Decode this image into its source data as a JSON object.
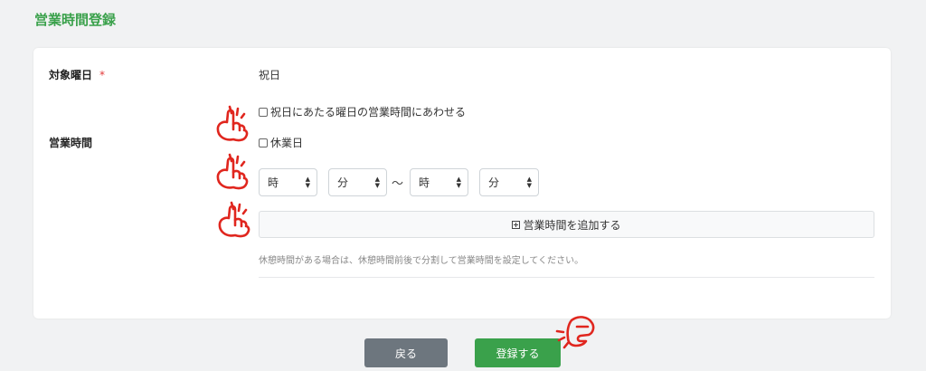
{
  "page": {
    "title": "営業時間登録"
  },
  "form": {
    "target_day": {
      "label": "対象曜日",
      "required_mark": "*",
      "value": "祝日"
    },
    "match_weekday_checkbox": {
      "label": "祝日にあたる曜日の営業時間にあわせる",
      "checked": false
    },
    "business_hours": {
      "label": "営業時間",
      "holiday_checkbox": {
        "label": "休業日",
        "checked": false
      },
      "start_hour": {
        "value": "時"
      },
      "start_minute": {
        "value": "分"
      },
      "separator": "〜",
      "end_hour": {
        "value": "時"
      },
      "end_minute": {
        "value": "分"
      },
      "add_button_label": "営業時間を追加する",
      "hint": "休憩時間がある場合は、休憩時間前後で分割して営業時間を設定してください。"
    }
  },
  "footer": {
    "back_label": "戻る",
    "submit_label": "登録する"
  },
  "colors": {
    "accent": "#3aa14b",
    "back_button": "#6d767e",
    "required": "#e23a3a",
    "annotation": "#e0261e"
  },
  "icons": {
    "pointer": "pointing-hand-icon",
    "add": "plus-square-icon"
  }
}
